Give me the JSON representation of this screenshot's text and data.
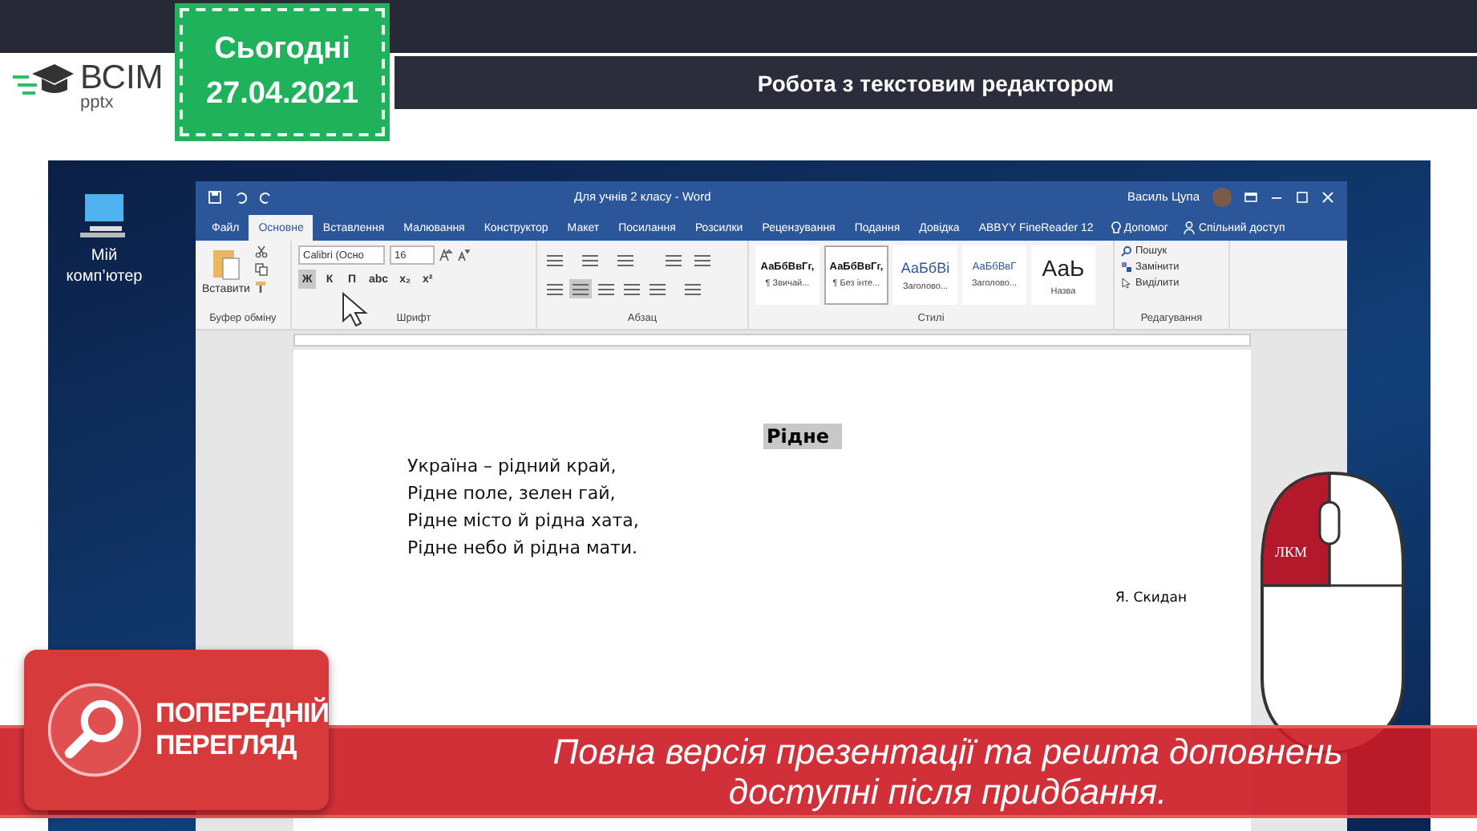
{
  "header": {
    "logo_text": "ВСІМ",
    "logo_sub": "pptx",
    "badge_day": "Сьогодні",
    "badge_date": "27.04.2021",
    "title": "Робота з текстовим редактором"
  },
  "desktop": {
    "icon_label": "Мій комп’ютер"
  },
  "word": {
    "title": "Для учнів 2 класу  -  Word",
    "user": "Василь Цупа",
    "tabs": [
      {
        "label": "Файл",
        "selected": false
      },
      {
        "label": "Основне",
        "selected": true
      },
      {
        "label": "Вставлення",
        "selected": false
      },
      {
        "label": "Малювання",
        "selected": false
      },
      {
        "label": "Конструктор",
        "selected": false
      },
      {
        "label": "Макет",
        "selected": false
      },
      {
        "label": "Посилання",
        "selected": false
      },
      {
        "label": "Розсилки",
        "selected": false
      },
      {
        "label": "Рецензування",
        "selected": false
      },
      {
        "label": "Подання",
        "selected": false
      },
      {
        "label": "Довідка",
        "selected": false
      },
      {
        "label": "ABBYY FineReader 12",
        "selected": false
      }
    ],
    "help": "Допомог",
    "share": "Спільний доступ",
    "paste": "Вставити",
    "clipboard_group": "Буфер обміну",
    "font_name": "Calibri (Осно",
    "font_size": "16",
    "font_buttons": [
      {
        "label": "Ж",
        "pressed": true
      },
      {
        "label": "К",
        "pressed": false
      },
      {
        "label": "П",
        "pressed": false
      },
      {
        "label": "abc",
        "pressed": false
      },
      {
        "label": "x₂",
        "pressed": false
      },
      {
        "label": "x²",
        "pressed": false
      }
    ],
    "font_group": "Шрифт",
    "paragraph_group": "Абзац",
    "styles": [
      {
        "sample": "АаБбВвГг,",
        "label": "¶ Звичай...",
        "selected": false,
        "kind": "body"
      },
      {
        "sample": "АаБбВвГг,",
        "label": "¶ Без інте...",
        "selected": true,
        "kind": "body"
      },
      {
        "sample": "АаБбВі",
        "label": "Заголово...",
        "selected": false,
        "kind": "heading"
      },
      {
        "sample": "АаБбВвГ",
        "label": "Заголово...",
        "selected": false,
        "kind": "heading2"
      },
      {
        "sample": "АаЬ",
        "label": "Назва",
        "selected": false,
        "kind": "title"
      }
    ],
    "styles_group": "Стилі",
    "editing": [
      {
        "label": "Пошук",
        "kind": "find"
      },
      {
        "label": "Замінити",
        "kind": "replace"
      },
      {
        "label": "Виділити",
        "kind": "select"
      }
    ],
    "editing_group": "Редагування",
    "document": {
      "heading": "Рідне",
      "lines": [
        "Україна – рідний край,",
        "Рідне поле, зелен гай,",
        "Рідне місто й рідна хата,",
        "Рідне небо й рідна мати."
      ],
      "author": "Я. Скидан"
    }
  },
  "mouse_label": "ЛКМ",
  "banner": {
    "preview_line1": "ПОПЕРЕДНІЙ",
    "preview_line2": "ПЕРЕГЛЯД",
    "message": "Повна версія презентації та решта доповнень доступні після придбання."
  }
}
